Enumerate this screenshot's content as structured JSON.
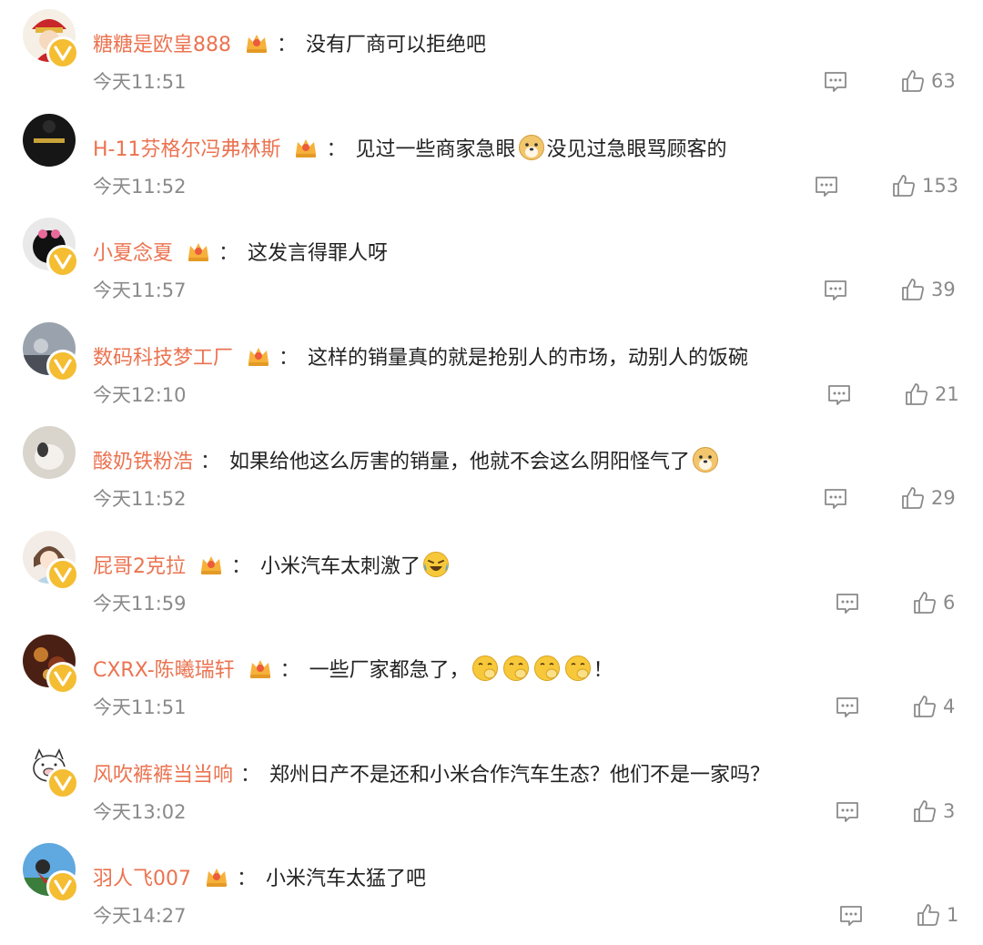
{
  "icons": {
    "vip": "crown-badge-icon",
    "verified": "verified-v-icon",
    "reply": "comment-bubble-icon",
    "like": "thumbs-up-icon",
    "emoji_doge": "doge-emoji",
    "emoji_laugh_cry": "laugh-cry-emoji",
    "emoji_clap": "clap-hands-emoji"
  },
  "colors": {
    "username": "#eb7350",
    "timestamp": "#8a8a8a",
    "verified_badge": "#f4bd32",
    "text": "#222222"
  },
  "comments": [
    {
      "user": "糖糖是欧皇888",
      "text": "没有厂商可以拒绝吧",
      "time": "今天11:51",
      "likes": "63"
    },
    {
      "user": "H-11芬格尔冯弗林斯",
      "text_a": "见过一些商家急眼",
      "text_b": "没见过急眼骂顾客的",
      "time": "今天11:52",
      "likes": "153"
    },
    {
      "user": "小夏念夏",
      "text": "这发言得罪人呀",
      "time": "今天11:57",
      "likes": "39"
    },
    {
      "user": "数码科技梦工厂",
      "text": "这样的销量真的就是抢别人的市场，动别人的饭碗",
      "time": "今天12:10",
      "likes": "21"
    },
    {
      "user": "酸奶铁粉浩",
      "text": "如果给他这么厉害的销量，他就不会这么阴阳怪气了",
      "time": "今天11:52",
      "likes": "29"
    },
    {
      "user": "屁哥2克拉",
      "text": "小米汽车太刺激了",
      "time": "今天11:59",
      "likes": "6"
    },
    {
      "user": "CXRX-陈曦瑞轩",
      "text": "一些厂家都急了，",
      "text_end": "！",
      "time": "今天11:51",
      "likes": "4"
    },
    {
      "user": "风吹裤裤当当响",
      "text": "郑州日产不是还和小米合作汽车生态？他们不是一家吗？",
      "time": "今天13:02",
      "likes": "3"
    },
    {
      "user": "羽人飞007",
      "text": "小米汽车太猛了吧",
      "time": "今天14:27",
      "likes": "1"
    }
  ],
  "separator": "："
}
